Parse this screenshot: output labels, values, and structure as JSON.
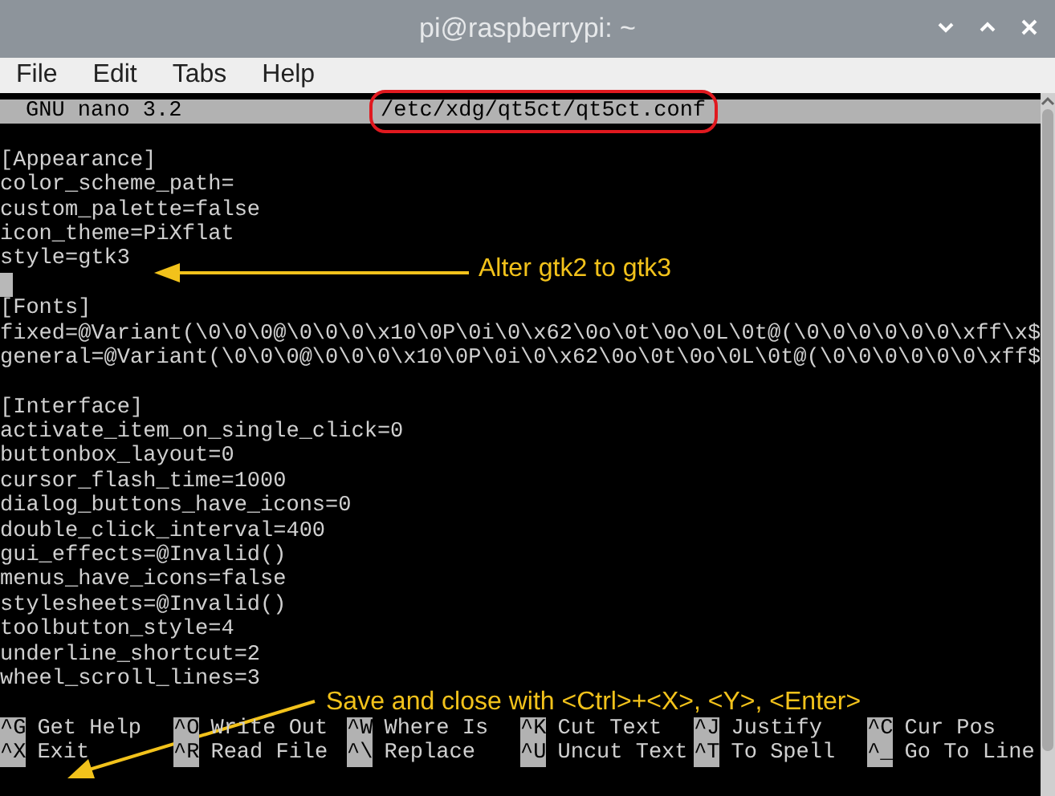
{
  "window": {
    "title": "pi@raspberrypi: ~"
  },
  "menu": [
    "File",
    "Edit",
    "Tabs",
    "Help"
  ],
  "nano": {
    "version": "GNU nano 3.2",
    "filename": "/etc/xdg/qt5ct/qt5ct.conf",
    "lines": [
      {
        "kind": "blank"
      },
      {
        "kind": "text",
        "text": "[Appearance]"
      },
      {
        "kind": "text",
        "text": "color_scheme_path="
      },
      {
        "kind": "text",
        "text": "custom_palette=false"
      },
      {
        "kind": "text",
        "text": "icon_theme=PiXflat"
      },
      {
        "kind": "text",
        "text": "style=gtk3"
      },
      {
        "kind": "cursor"
      },
      {
        "kind": "text",
        "text": "[Fonts]"
      },
      {
        "kind": "text",
        "text": "fixed=@Variant(\\0\\0\\0@\\0\\0\\0\\x10\\0P\\0i\\0\\x62\\0o\\0t\\0o\\0L\\0t@(\\0\\0\\0\\0\\0\\0\\xff\\x$"
      },
      {
        "kind": "text",
        "text": "general=@Variant(\\0\\0\\0@\\0\\0\\0\\x10\\0P\\0i\\0\\x62\\0o\\0t\\0o\\0L\\0t@(\\0\\0\\0\\0\\0\\0\\xff$"
      },
      {
        "kind": "blank"
      },
      {
        "kind": "text",
        "text": "[Interface]"
      },
      {
        "kind": "text",
        "text": "activate_item_on_single_click=0"
      },
      {
        "kind": "text",
        "text": "buttonbox_layout=0"
      },
      {
        "kind": "text",
        "text": "cursor_flash_time=1000"
      },
      {
        "kind": "text",
        "text": "dialog_buttons_have_icons=0"
      },
      {
        "kind": "text",
        "text": "double_click_interval=400"
      },
      {
        "kind": "text",
        "text": "gui_effects=@Invalid()"
      },
      {
        "kind": "text",
        "text": "menus_have_icons=false"
      },
      {
        "kind": "text",
        "text": "stylesheets=@Invalid()"
      },
      {
        "kind": "text",
        "text": "toolbutton_style=4"
      },
      {
        "kind": "text",
        "text": "underline_shortcut=2"
      },
      {
        "kind": "text",
        "text": "wheel_scroll_lines=3"
      },
      {
        "kind": "blank"
      }
    ],
    "shortcuts": [
      {
        "key": "^G",
        "label": "Get Help"
      },
      {
        "key": "^O",
        "label": "Write Out"
      },
      {
        "key": "^W",
        "label": "Where Is"
      },
      {
        "key": "^K",
        "label": "Cut Text"
      },
      {
        "key": "^J",
        "label": "Justify"
      },
      {
        "key": "^C",
        "label": "Cur Pos"
      },
      {
        "key": "^X",
        "label": "Exit"
      },
      {
        "key": "^R",
        "label": "Read File"
      },
      {
        "key": "^\\",
        "label": "Replace"
      },
      {
        "key": "^U",
        "label": "Uncut Text"
      },
      {
        "key": "^T",
        "label": "To Spell"
      },
      {
        "key": "^_",
        "label": "Go To Line"
      }
    ]
  },
  "annotations": [
    {
      "text": "Alter gtk2 to gtk3"
    },
    {
      "text": "Save and close with <Ctrl>+<X>, <Y>, <Enter>"
    }
  ]
}
